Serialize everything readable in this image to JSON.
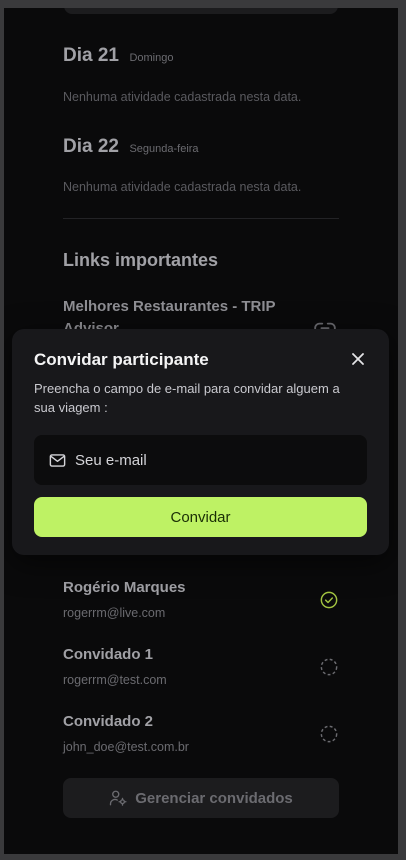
{
  "activities": [
    {
      "day": "Dia 21",
      "weekday": "Domingo",
      "empty_text": "Nenhuma atividade cadastrada nesta data."
    },
    {
      "day": "Dia 22",
      "weekday": "Segunda-feira",
      "empty_text": "Nenhuma atividade cadastrada nesta data."
    }
  ],
  "links_section": {
    "title": "Links importantes",
    "items": [
      {
        "title": "Melhores Restaurantes - TRIP Advisor"
      }
    ]
  },
  "guests": {
    "items": [
      {
        "name": "Rogério Marques",
        "email": "rogerrm@live.com",
        "status": "confirmed"
      },
      {
        "name": "Convidado 1",
        "email": "rogerrm@test.com",
        "status": "pending"
      },
      {
        "name": "Convidado 2",
        "email": "john_doe@test.com.br",
        "status": "pending"
      }
    ],
    "manage_label": "Gerenciar convidados"
  },
  "modal": {
    "title": "Convidar participante",
    "description": "Preencha o campo de e-mail para convidar alguem a sua viagem :",
    "email_placeholder": "Seu e-mail",
    "invite_label": "Convidar"
  },
  "colors": {
    "accent": "#bef264",
    "background": "#0a0a0b",
    "modal_background": "#18181b"
  },
  "icons": {
    "close": "close-icon",
    "mail": "mail-icon",
    "link": "link-icon",
    "confirmed": "circle-check-icon",
    "pending": "circle-dashed-icon",
    "manage": "user-cog-icon"
  }
}
